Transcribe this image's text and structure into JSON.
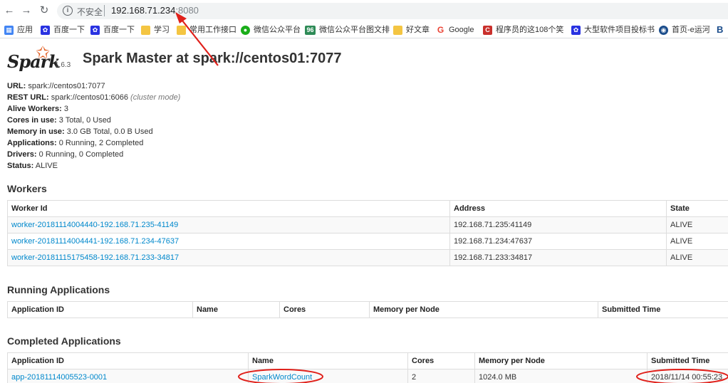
{
  "browser": {
    "insecure_label": "不安全",
    "url_host": "192.168.71.234",
    "url_port": ":8080"
  },
  "bookmarks": [
    {
      "label": "应用",
      "icon": "apps-grid-icon",
      "color": "#4285f4"
    },
    {
      "label": "百度一下",
      "icon": "baidu-paw-icon",
      "color": "#2932e1"
    },
    {
      "label": "百度一下",
      "icon": "baidu-paw-icon",
      "color": "#2932e1"
    },
    {
      "label": "学习",
      "icon": "folder-icon",
      "color": "#f4c542"
    },
    {
      "label": "常用工作接口",
      "icon": "folder-icon",
      "color": "#f4c542"
    },
    {
      "label": "微信公众平台",
      "icon": "wechat-icon",
      "color": "#1aad19"
    },
    {
      "label": "微信公众平台图文排",
      "icon": "96-icon",
      "color": "#2e8b57"
    },
    {
      "label": "好文章",
      "icon": "folder-icon",
      "color": "#f4c542"
    },
    {
      "label": "Google",
      "icon": "google-icon",
      "color": "#ea4335"
    },
    {
      "label": "程序员的这108个笑",
      "icon": "csdn-icon",
      "color": "#c9302c"
    },
    {
      "label": "大型软件项目投标书",
      "icon": "baidu-paw-icon",
      "color": "#2932e1"
    },
    {
      "label": "首页-e运河",
      "icon": "globe-icon",
      "color": "#1a4c8b"
    }
  ],
  "spark": {
    "logo_text": "Spark",
    "version": "1.6.3",
    "title": "Spark Master at spark://centos01:7077"
  },
  "summary": {
    "url_label": "URL:",
    "url_value": "spark://centos01:7077",
    "rest_label": "REST URL:",
    "rest_value": "spark://centos01:6066",
    "rest_mode": "(cluster mode)",
    "workers_label": "Alive Workers:",
    "workers_value": "3",
    "cores_label": "Cores in use:",
    "cores_value": "3 Total, 0 Used",
    "memory_label": "Memory in use:",
    "memory_value": "3.0 GB Total, 0.0 B Used",
    "apps_label": "Applications:",
    "apps_value": "0 Running, 2 Completed",
    "drivers_label": "Drivers:",
    "drivers_value": "0 Running, 0 Completed",
    "status_label": "Status:",
    "status_value": "ALIVE"
  },
  "workers": {
    "title": "Workers",
    "headers": [
      "Worker Id",
      "Address",
      "State"
    ],
    "rows": [
      [
        "worker-20181114004440-192.168.71.235-41149",
        "192.168.71.235:41149",
        "ALIVE"
      ],
      [
        "worker-20181114004441-192.168.71.234-47637",
        "192.168.71.234:47637",
        "ALIVE"
      ],
      [
        "worker-20181115175458-192.168.71.233-34817",
        "192.168.71.233:34817",
        "ALIVE"
      ]
    ]
  },
  "running": {
    "title": "Running Applications",
    "headers": [
      "Application ID",
      "Name",
      "Cores",
      "Memory per Node",
      "Submitted Time"
    ]
  },
  "completed": {
    "title": "Completed Applications",
    "headers": [
      "Application ID",
      "Name",
      "Cores",
      "Memory per Node",
      "Submitted Time"
    ],
    "rows": [
      [
        "app-20181114005523-0001",
        "SparkWordCount",
        "2",
        "1024.0 MB",
        "2018/11/14 00:55:23"
      ]
    ]
  },
  "annotation_color": "#e0201a"
}
